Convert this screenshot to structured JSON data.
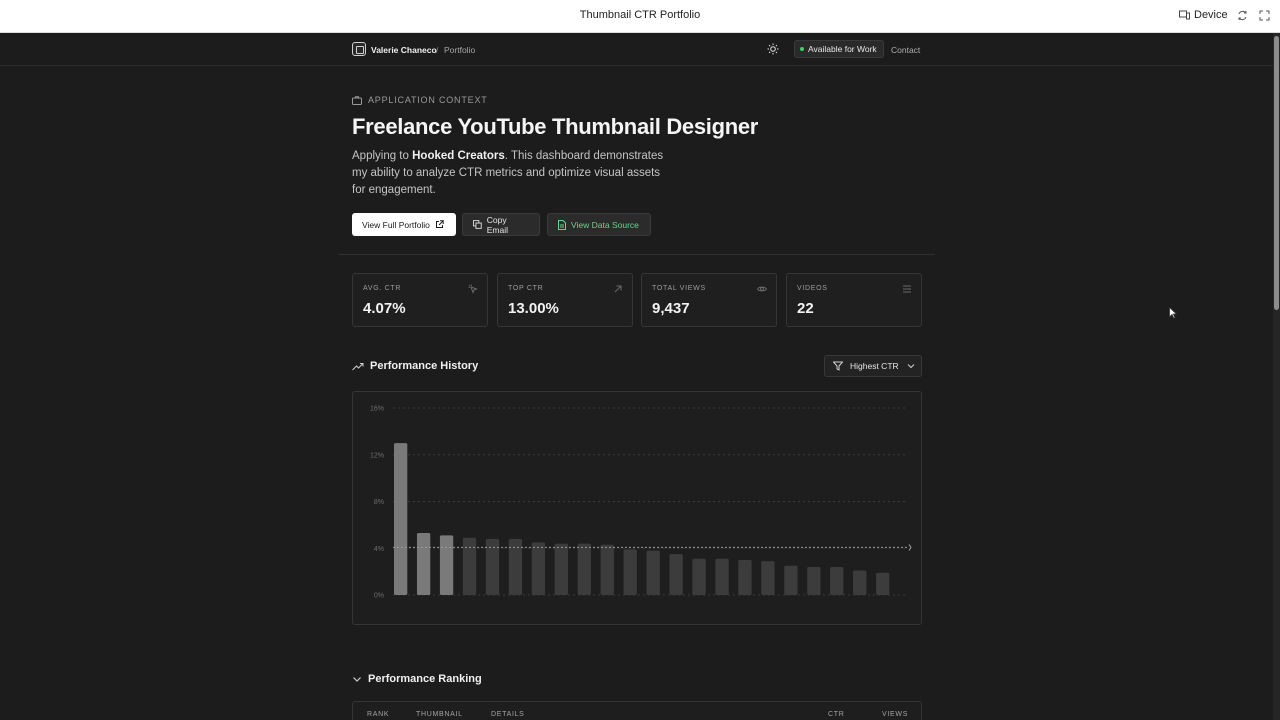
{
  "window": {
    "title": "Thumbnail CTR Portfolio",
    "device_label": "Device"
  },
  "header": {
    "name": "Valerie Chaneco",
    "separator": "/",
    "page": "Portfolio",
    "status": "Available for Work",
    "contact": "Contact"
  },
  "hero": {
    "context_label": "APPLICATION CONTEXT",
    "title": "Freelance YouTube Thumbnail Designer",
    "lead_prefix": "Applying to ",
    "lead_company": "Hooked Creators",
    "lead_suffix": ". This dashboard demonstrates my ability to analyze CTR metrics and optimize visual assets for engagement.",
    "buttons": {
      "portfolio": "View Full Portfolio",
      "email": "Copy Email",
      "source": "View Data Source"
    }
  },
  "stats": [
    {
      "label": "AVG. CTR",
      "value": "4.07%",
      "icon": "cursor-click-icon"
    },
    {
      "label": "TOP CTR",
      "value": "13.00%",
      "icon": "arrow-up-right-icon"
    },
    {
      "label": "TOTAL VIEWS",
      "value": "9,437",
      "icon": "eye-icon"
    },
    {
      "label": "VIDEOS",
      "value": "22",
      "icon": "list-icon"
    }
  ],
  "history": {
    "title": "Performance History",
    "filter_label": "Highest CTR"
  },
  "ranking": {
    "title": "Performance Ranking",
    "columns": [
      "RANK",
      "THUMBNAIL",
      "DETAILS",
      "CTR",
      "VIEWS"
    ]
  },
  "colors": {
    "background": "#1c1c1c",
    "bar_highlight": "#7a7a7a",
    "bar_muted": "#3c3c3c",
    "accent_green": "#6fd08a"
  },
  "chart_data": {
    "type": "bar",
    "ylim": [
      0,
      16
    ],
    "yticks": [
      "0%",
      "4%",
      "8%",
      "12%",
      "16%"
    ],
    "reference_line": 4.07,
    "values": [
      13.0,
      5.3,
      5.1,
      4.9,
      4.8,
      4.8,
      4.5,
      4.4,
      4.4,
      4.3,
      3.9,
      3.8,
      3.5,
      3.1,
      3.1,
      3.0,
      2.9,
      2.5,
      2.4,
      2.4,
      2.1,
      1.9
    ],
    "highlighted_count": 3
  }
}
